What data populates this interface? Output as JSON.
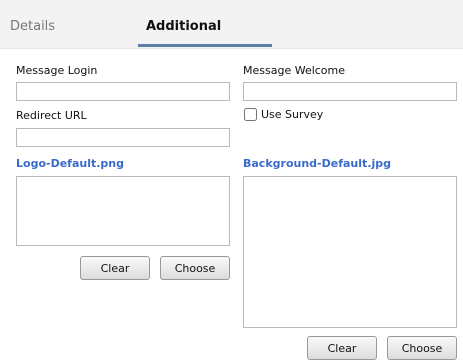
{
  "tabs": {
    "details_label": "Details",
    "additional_label": "Additional"
  },
  "form": {
    "message_login_label": "Message Login",
    "message_login_value": "",
    "message_welcome_label": "Message Welcome",
    "message_welcome_value": "",
    "redirect_url_label": "Redirect URL",
    "redirect_url_value": "",
    "use_survey_label": "Use Survey",
    "use_survey_checked": false
  },
  "logo": {
    "filename": "Logo-Default.png",
    "clear_label": "Clear",
    "choose_label": "Choose"
  },
  "background": {
    "filename": "Background-Default.jpg",
    "clear_label": "Clear",
    "choose_label": "Choose"
  }
}
